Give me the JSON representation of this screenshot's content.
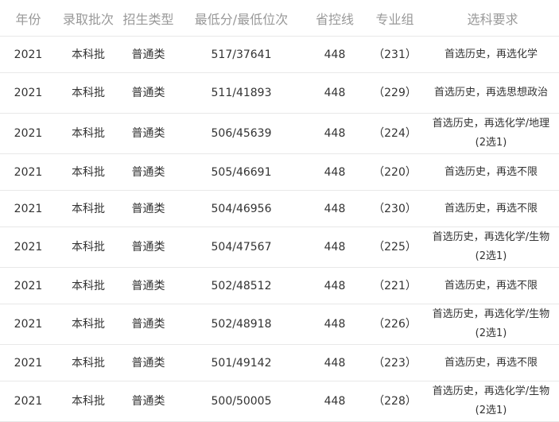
{
  "table": {
    "headers": {
      "year": "年份",
      "batch": "录取批次",
      "type": "招生类型",
      "score": "最低分/最低位次",
      "control_line": "省控线",
      "group": "专业组",
      "requirement": "选科要求"
    },
    "rows": [
      {
        "year": "2021",
        "batch": "本科批",
        "type": "普通类",
        "score": "517/37641",
        "control_line": "448",
        "group": "（231）",
        "requirement": "首选历史，再选化学"
      },
      {
        "year": "2021",
        "batch": "本科批",
        "type": "普通类",
        "score": "511/41893",
        "control_line": "448",
        "group": "（229）",
        "requirement": "首选历史，再选思想政治"
      },
      {
        "year": "2021",
        "batch": "本科批",
        "type": "普通类",
        "score": "506/45639",
        "control_line": "448",
        "group": "（224）",
        "requirement": "首选历史，再选化学/地理(2选1)"
      },
      {
        "year": "2021",
        "batch": "本科批",
        "type": "普通类",
        "score": "505/46691",
        "control_line": "448",
        "group": "（220）",
        "requirement": "首选历史，再选不限"
      },
      {
        "year": "2021",
        "batch": "本科批",
        "type": "普通类",
        "score": "504/46956",
        "control_line": "448",
        "group": "（230）",
        "requirement": "首选历史，再选不限"
      },
      {
        "year": "2021",
        "batch": "本科批",
        "type": "普通类",
        "score": "504/47567",
        "control_line": "448",
        "group": "（225）",
        "requirement": "首选历史，再选化学/生物(2选1)"
      },
      {
        "year": "2021",
        "batch": "本科批",
        "type": "普通类",
        "score": "502/48512",
        "control_line": "448",
        "group": "（221）",
        "requirement": "首选历史，再选不限"
      },
      {
        "year": "2021",
        "batch": "本科批",
        "type": "普通类",
        "score": "502/48918",
        "control_line": "448",
        "group": "（226）",
        "requirement": "首选历史，再选化学/生物(2选1)"
      },
      {
        "year": "2021",
        "batch": "本科批",
        "type": "普通类",
        "score": "501/49142",
        "control_line": "448",
        "group": "（223）",
        "requirement": "首选历史，再选不限"
      },
      {
        "year": "2021",
        "batch": "本科批",
        "type": "普通类",
        "score": "500/50005",
        "control_line": "448",
        "group": "（228）",
        "requirement": "首选历史，再选化学/生物(2选1)"
      }
    ]
  }
}
